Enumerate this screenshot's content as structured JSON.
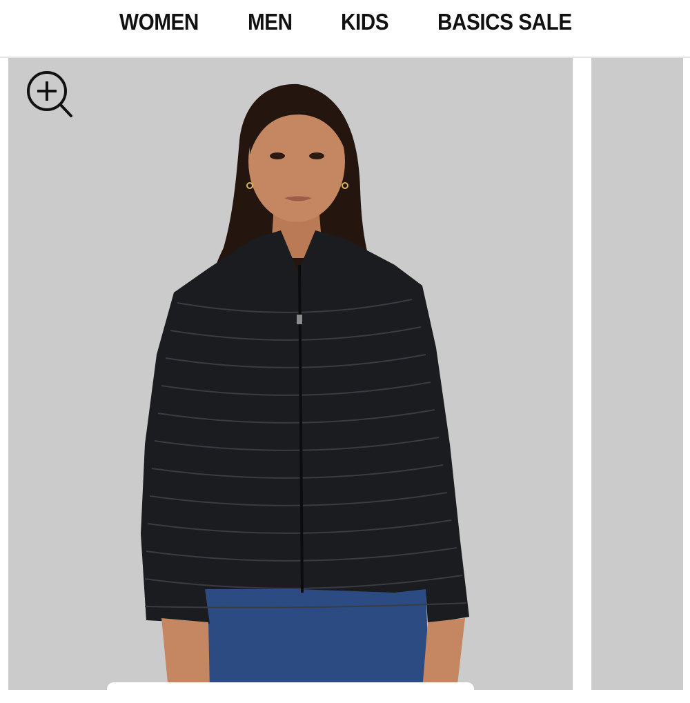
{
  "nav": {
    "items": [
      {
        "label": "WOMEN"
      },
      {
        "label": "MEN"
      },
      {
        "label": "KIDS"
      },
      {
        "label": "BASICS SALE"
      }
    ]
  },
  "gallery": {
    "zoom_icon": "zoom-in-icon",
    "main_image": "woman-black-puffer-jacket",
    "next_image": "next-product-image"
  },
  "colors": {
    "nav_text": "#111111",
    "image_background": "#cbcbcb",
    "jacket": "#1b1c20",
    "jeans": "#2c4b83"
  }
}
